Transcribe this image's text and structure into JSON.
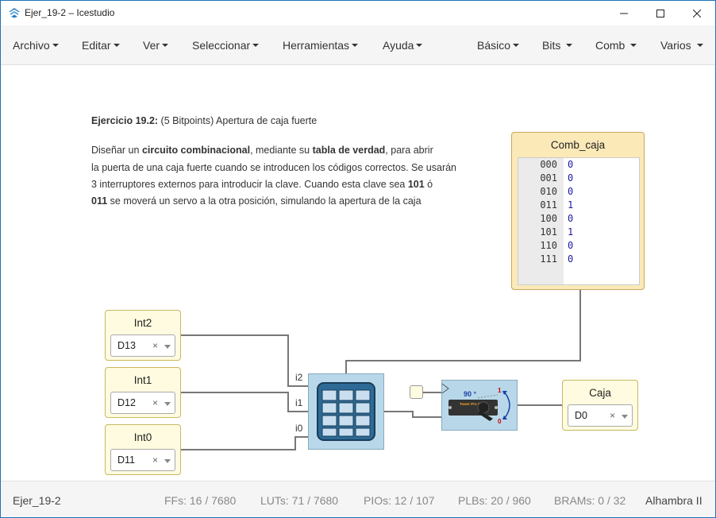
{
  "window": {
    "title": "Ejer_19-2 – Icestudio"
  },
  "menu": {
    "left": [
      "Archivo",
      "Editar",
      "Ver",
      "Seleccionar",
      "Herramientas",
      "Ayuda"
    ],
    "right": [
      "Básico",
      "Bits",
      "Comb",
      "Varios"
    ]
  },
  "description": {
    "line1_bold": "Ejercicio 19.2:",
    "line1_rest": " (5 Bitpoints) Apertura de caja fuerte",
    "p1_a": "Diseñar un ",
    "p1_b": "circuito combinacional",
    "p1_c": ", mediante su ",
    "p1_d": "tabla de verdad",
    "p1_e": ", para abrir",
    "p2": "la puerta de una caja fuerte cuando se introducen los códigos correctos. Se usarán",
    "p3_a": "3 interruptores externos para introducir la clave. Cuando esta clave sea ",
    "p3_b": "101",
    "p3_c": " ó",
    "p4_a": "011",
    "p4_b": " se moverá un servo a la otra posición, simulando la apertura de la caja"
  },
  "truth_table": {
    "title": "Comb_caja",
    "rows": [
      {
        "key": "000",
        "value": "0"
      },
      {
        "key": "001",
        "value": "0"
      },
      {
        "key": "010",
        "value": "0"
      },
      {
        "key": "011",
        "value": "1"
      },
      {
        "key": "100",
        "value": "0"
      },
      {
        "key": "101",
        "value": "1"
      },
      {
        "key": "110",
        "value": "0"
      },
      {
        "key": "111",
        "value": "0"
      }
    ]
  },
  "inputs": [
    {
      "title": "Int2",
      "pin": "D13"
    },
    {
      "title": "Int1",
      "pin": "D12"
    },
    {
      "title": "Int0",
      "pin": "D11"
    }
  ],
  "lut_ports": [
    "i2",
    "i1",
    "i0"
  ],
  "servo": {
    "angle_label": "90 °",
    "label_one": "1",
    "label_zero": "0",
    "brand": "Tower Pro SG90"
  },
  "output": {
    "title": "Caja",
    "pin": "D0"
  },
  "clear_glyph": "×",
  "status": {
    "file": "Ejer_19-2",
    "ffs": "FFs:  16 / 7680",
    "luts": "LUTs:  71 / 7680",
    "pios": "PIOs:  12 / 107",
    "plbs": "PLBs:  20 / 960",
    "brams": "BRAMs:  0 / 32",
    "board": "Alhambra II"
  },
  "colors": {
    "accent": "#1e73b8",
    "block_yellow": "#fffbe0",
    "table_bg": "#fbe9b8",
    "module_blue": "#b8d8ea"
  }
}
